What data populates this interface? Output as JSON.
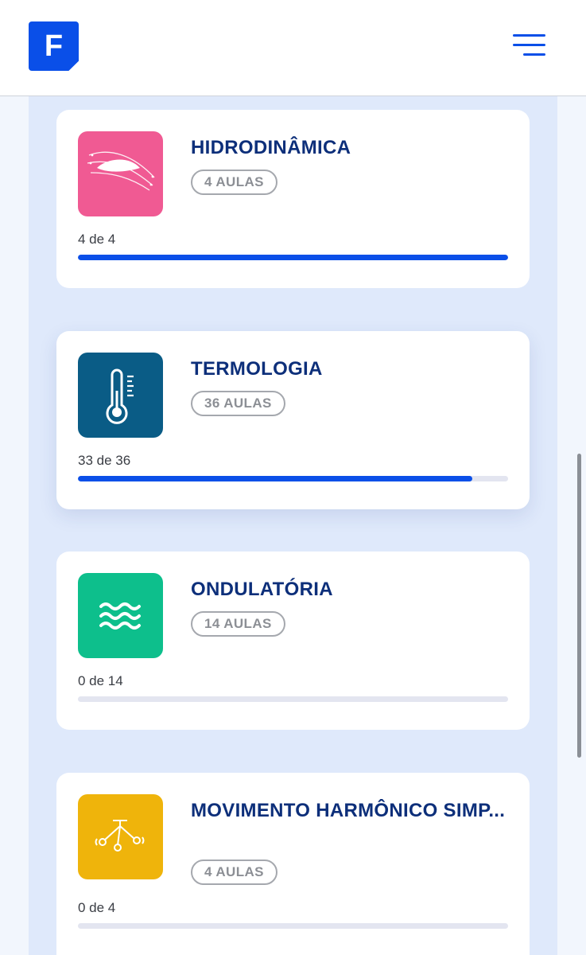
{
  "header": {
    "logo_letter": "F",
    "brand_color": "#0a4fe8"
  },
  "courses": [
    {
      "title": "HIDRODINÂMICA",
      "lessons_badge": "4 AULAS",
      "progress_text": "4 de 4",
      "completed": 4,
      "total": 4,
      "icon": "airfoil-icon",
      "icon_bg": "#f05a93"
    },
    {
      "title": "TERMOLOGIA",
      "lessons_badge": "36 AULAS",
      "progress_text": "33 de 36",
      "completed": 33,
      "total": 36,
      "icon": "thermometer-icon",
      "icon_bg": "#0a5c86"
    },
    {
      "title": "ONDULATÓRIA",
      "lessons_badge": "14 AULAS",
      "progress_text": "0 de 14",
      "completed": 0,
      "total": 14,
      "icon": "waves-icon",
      "icon_bg": "#0dbf8c"
    },
    {
      "title": "MOVIMENTO HARMÔNICO SIMP...",
      "lessons_badge": "4 AULAS",
      "progress_text": "0 de 4",
      "completed": 0,
      "total": 4,
      "icon": "pendulum-icon",
      "icon_bg": "#efb40b"
    }
  ]
}
